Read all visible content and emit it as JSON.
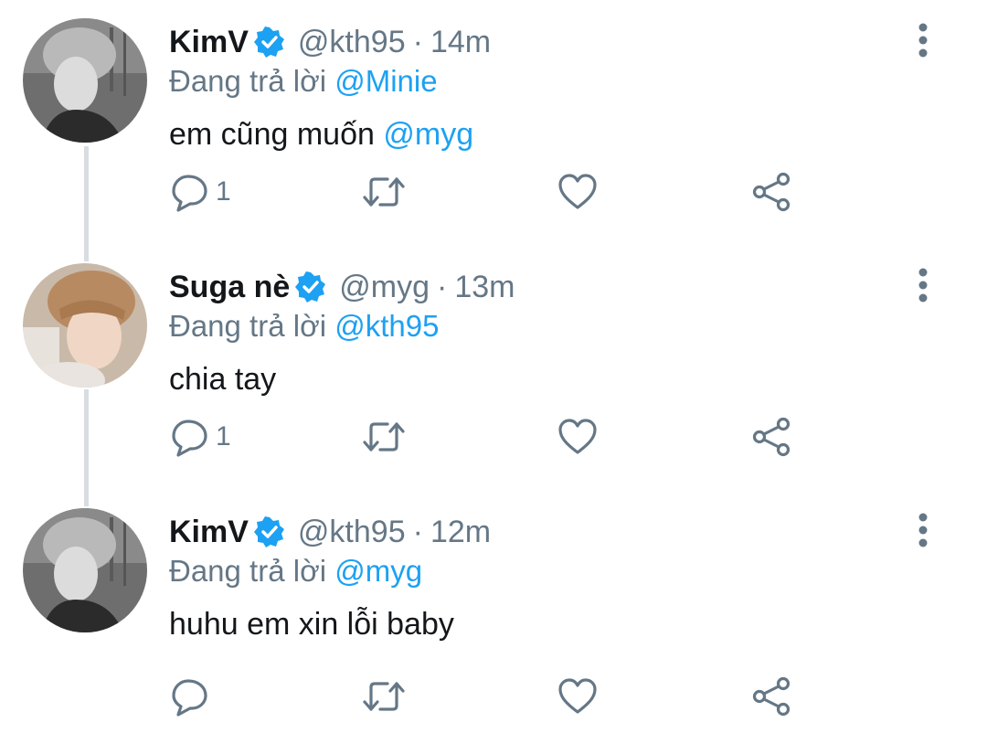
{
  "tweets": [
    {
      "display_name": "KimV",
      "handle": "@kth95",
      "separator": "·",
      "time": "14m",
      "reply_prefix": "Đang trả lời",
      "reply_to": "@Minie",
      "text": "em cũng muốn",
      "text_mention": "@myg",
      "reply_count": "1",
      "avatar": "avatar-kimv"
    },
    {
      "display_name": "Suga nè",
      "handle": "@myg",
      "separator": "·",
      "time": "13m",
      "reply_prefix": "Đang trả lời",
      "reply_to": "@kth95",
      "text": "chia tay",
      "text_mention": "",
      "reply_count": "1",
      "avatar": "avatar-suga"
    },
    {
      "display_name": "KimV",
      "handle": "@kth95",
      "separator": "·",
      "time": "12m",
      "reply_prefix": "Đang trả lời",
      "reply_to": "@myg",
      "text": "huhu em xin lỗi baby",
      "text_mention": "",
      "reply_count": "",
      "avatar": "avatar-kimv"
    }
  ],
  "icons": {
    "reply": "reply-icon",
    "retweet": "retweet-icon",
    "like": "like-icon",
    "share": "share-icon",
    "more": "more-vertical-icon",
    "verified": "verified-badge-icon"
  },
  "colors": {
    "text": "#14171a",
    "secondary": "#657786",
    "accent": "#1da1f2",
    "thread_line": "#d9dde1"
  }
}
